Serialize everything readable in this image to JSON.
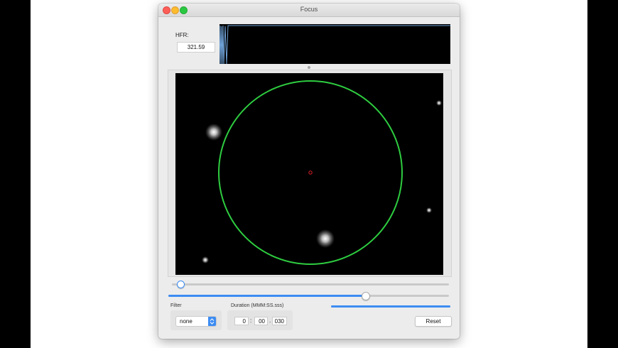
{
  "window": {
    "title": "Focus"
  },
  "hfr": {
    "label": "HFR:",
    "value": "321.59"
  },
  "controls": {
    "top_slider_value": 0.03,
    "bottom_slider_value": 0.7,
    "progress_value": 1.0,
    "filter_label": "Filter",
    "filter_value": "none",
    "duration_label": "Duration (MMM:SS.sss)",
    "duration_minutes": "0",
    "duration_seconds": "00",
    "duration_millis": "030",
    "sep_colon": ":",
    "sep_dot": ".",
    "reset_label": "Reset"
  },
  "colors": {
    "accent": "#3c8cf3",
    "focus_circle": "#2ecc40",
    "center_marker": "#e0202a"
  }
}
